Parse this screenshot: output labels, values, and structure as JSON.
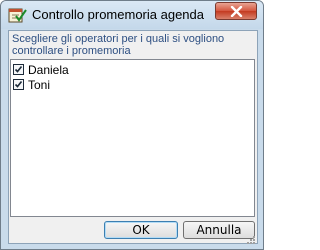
{
  "window": {
    "title": "Controllo promemoria agenda",
    "close_icon": "close-icon",
    "app_icon": "agenda-check-icon"
  },
  "instructions": "Scegliere gli operatori per i quali si vogliono controllare i promemoria",
  "operators": [
    {
      "label": "Daniela",
      "checked": true
    },
    {
      "label": "Toni",
      "checked": true
    }
  ],
  "buttons": {
    "ok_label": "OK",
    "cancel_label": "Annulla"
  },
  "colors": {
    "instructions_text": "#2d4f82",
    "close_button": "#c43a20",
    "titlebar": "#c4d8ea"
  }
}
